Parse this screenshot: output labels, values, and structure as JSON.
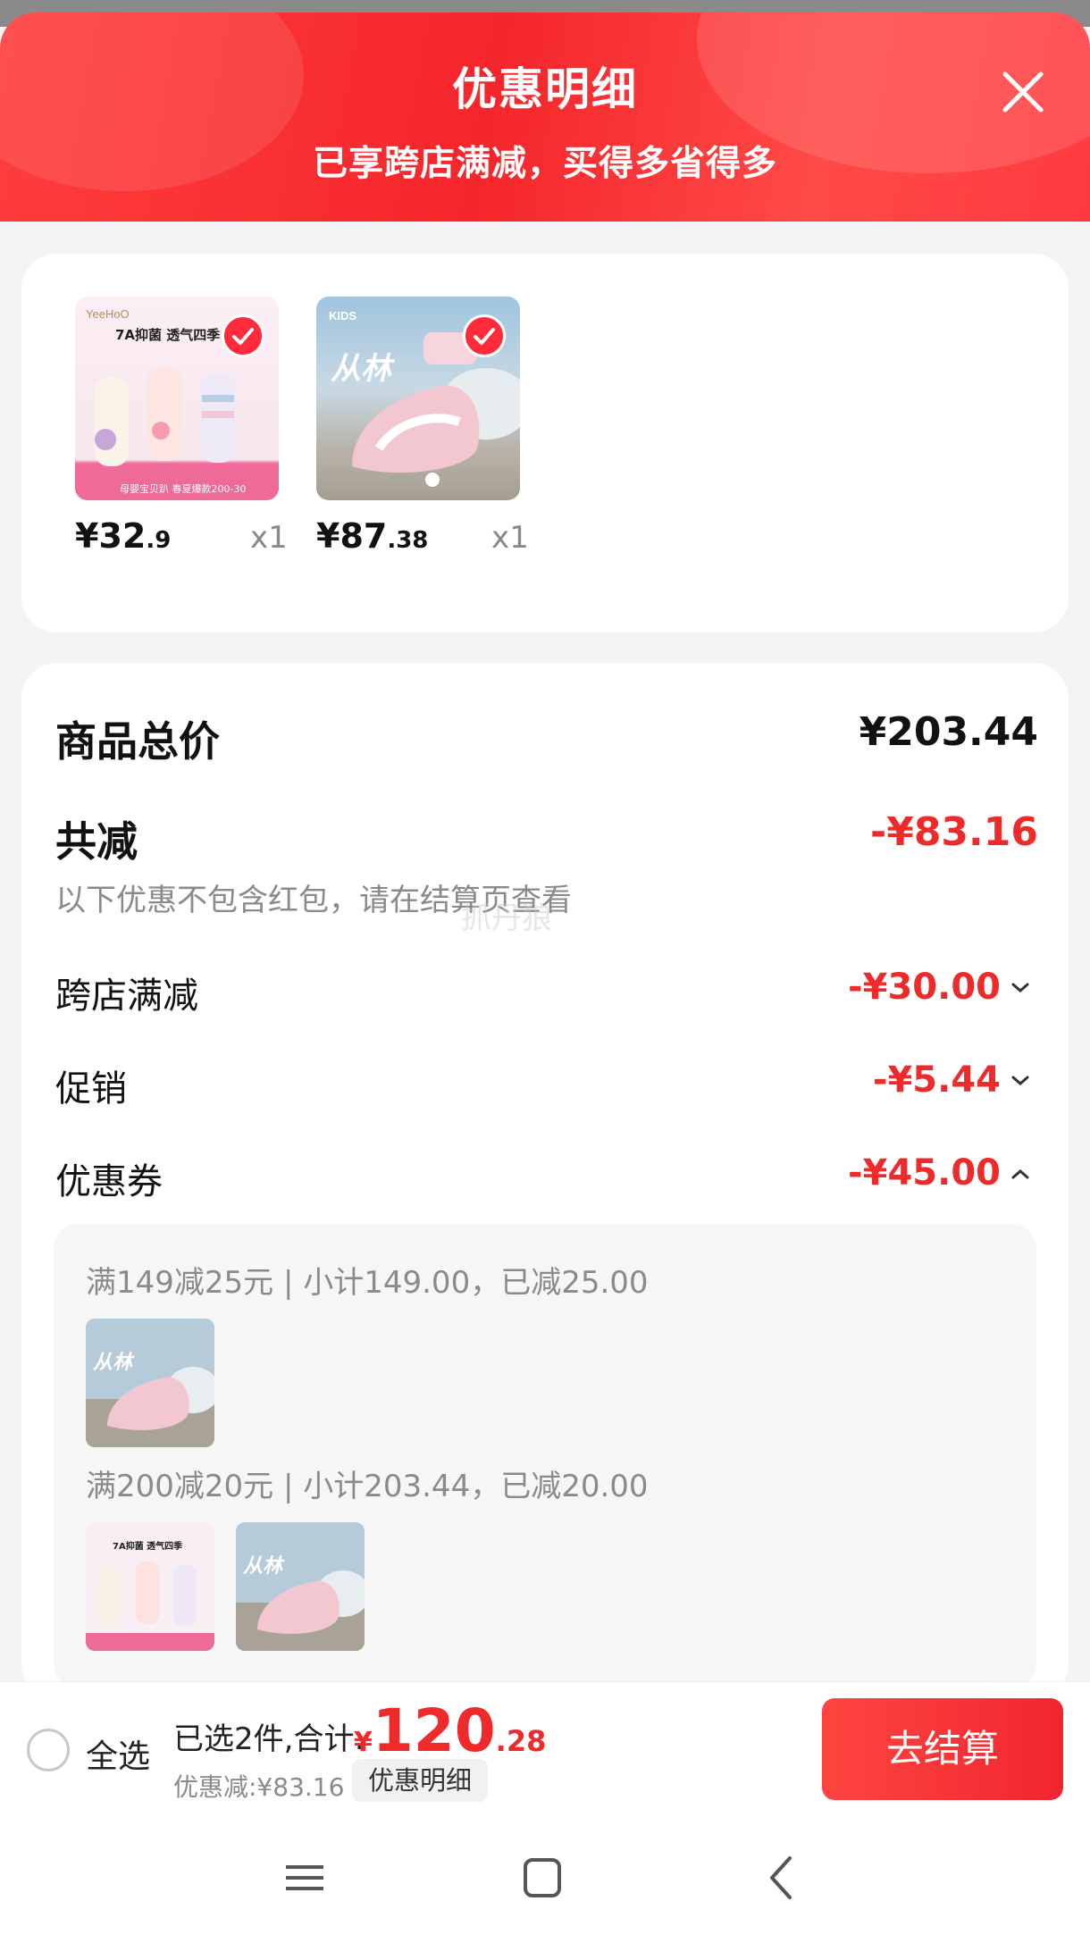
{
  "header": {
    "title": "优惠明细",
    "subtitle": "已享跨店满减，买得多省得多"
  },
  "products": [
    {
      "name": "socks-product",
      "thumb_text_top": "7A抑菌 透气四季",
      "thumb_brand": "YeeHoO",
      "thumb_banner": "母婴宝贝趴 春夏爆款200-30",
      "price_int": "¥32",
      "price_dec": ".9",
      "qty": "x1",
      "selected": true
    },
    {
      "name": "shoes-product",
      "thumb_text_top": "从林",
      "thumb_brand": "KIDS",
      "price_int": "¥87",
      "price_dec": ".38",
      "qty": "x1",
      "selected": true
    }
  ],
  "summary": {
    "total_label": "商品总价",
    "total_value": "¥203.44",
    "discount_label": "共减",
    "discount_value": "-¥83.16",
    "note": "以下优惠不包含红包，请在结算页查看",
    "watermark": "抓丹狼",
    "lines": [
      {
        "label": "跨店满减",
        "value": "-¥30.00",
        "expanded": false
      },
      {
        "label": "促销",
        "value": "-¥5.44",
        "expanded": false
      },
      {
        "label": "优惠券",
        "value": "-¥45.00",
        "expanded": true
      }
    ]
  },
  "coupons": [
    {
      "text": "满149减25元 | 小计149.00，已减25.00"
    },
    {
      "text": "满200减20元 | 小计203.44，已减20.00"
    }
  ],
  "bottom_bar": {
    "select_all": "全选",
    "selected_count": "已选2件,合计:",
    "currency": "¥",
    "total_int": "120",
    "total_dec": ".28",
    "saved": "优惠减:¥83.16",
    "detail_button": "优惠明细",
    "checkout": "去结算"
  },
  "colors": {
    "accent_red": "#ee2a2a",
    "header_red": "#f5262b"
  }
}
